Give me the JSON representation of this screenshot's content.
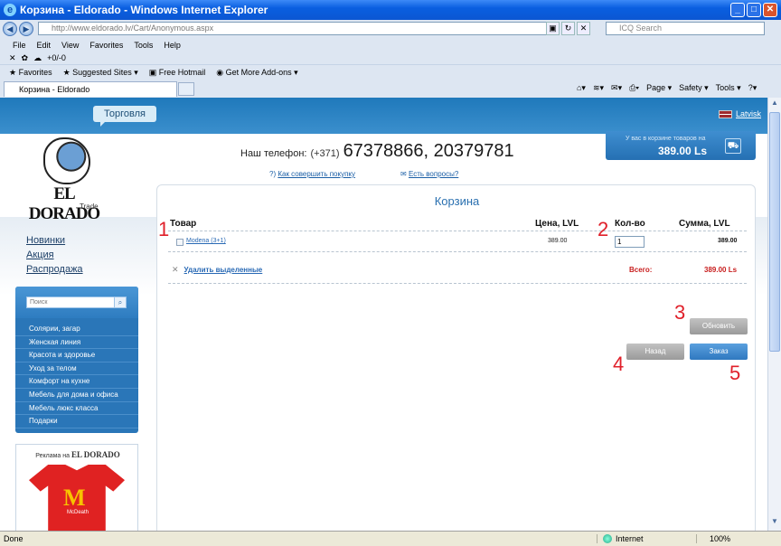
{
  "window": {
    "title": "Корзина - Eldorado - Windows Internet Explorer",
    "address": "http://www.eldorado.lv/Cart/Anonymous.aspx",
    "search_placeholder": "ICQ Search",
    "menu": [
      "File",
      "Edit",
      "View",
      "Favorites",
      "Tools",
      "Help"
    ],
    "icq_temp": "+0/-0",
    "favorites": [
      "Favorites",
      "Suggested Sites ▾",
      "Free Hotmail",
      "Get More Add-ons ▾"
    ],
    "tab_label": "Корзина - Eldorado",
    "commands": [
      "Page ▾",
      "Safety ▾",
      "Tools ▾"
    ]
  },
  "site": {
    "trade_button": "Торговля",
    "language": "Latvisk",
    "logo_word": "EL DORADO",
    "logo_sub": "Trade",
    "phone_label": "Наш телефон:",
    "phone_code": "(+371)",
    "phone_numbers": "67378866, 20379781",
    "help_links": [
      "Как совершить покупку",
      "Есть вопросы?"
    ],
    "cart_summary_text": "У вас в корзине товаров на",
    "cart_summary_sum": "389.00 Ls",
    "side_links": [
      "Новинки",
      "Акция",
      "Распродажа"
    ],
    "search_placeholder": "Поиск",
    "categories": [
      "Солярии, загар",
      "Женская линия",
      "Красота и здоровье",
      "Уход за телом",
      "Комфорт на кухне",
      "Мебель для дома и офиса",
      "Мебель люкс класса",
      "Подарки"
    ],
    "ad_header": "Реклама на",
    "ad_logo": "EL DORADO",
    "ad_shirt_m": "M",
    "ad_shirt_text": "McDeath"
  },
  "cart": {
    "title": "Корзина",
    "headers": {
      "product": "Товар",
      "price": "Цена, LVL",
      "qty": "Кол-во",
      "sum": "Сумма, LVL"
    },
    "item": {
      "name": "Modena (3+1)",
      "price": "389.00",
      "qty": "1",
      "sum": "389.00"
    },
    "delete_label": "Удалить выделенные",
    "total_label": "Всего:",
    "total_value": "389.00 Ls",
    "btn_refresh": "Обновить",
    "btn_back": "Назад",
    "btn_order": "Заказ"
  },
  "annotations": [
    "1",
    "2",
    "3",
    "4",
    "5"
  ],
  "status": {
    "text": "Done",
    "zone": "Internet",
    "zoom": "100%"
  }
}
